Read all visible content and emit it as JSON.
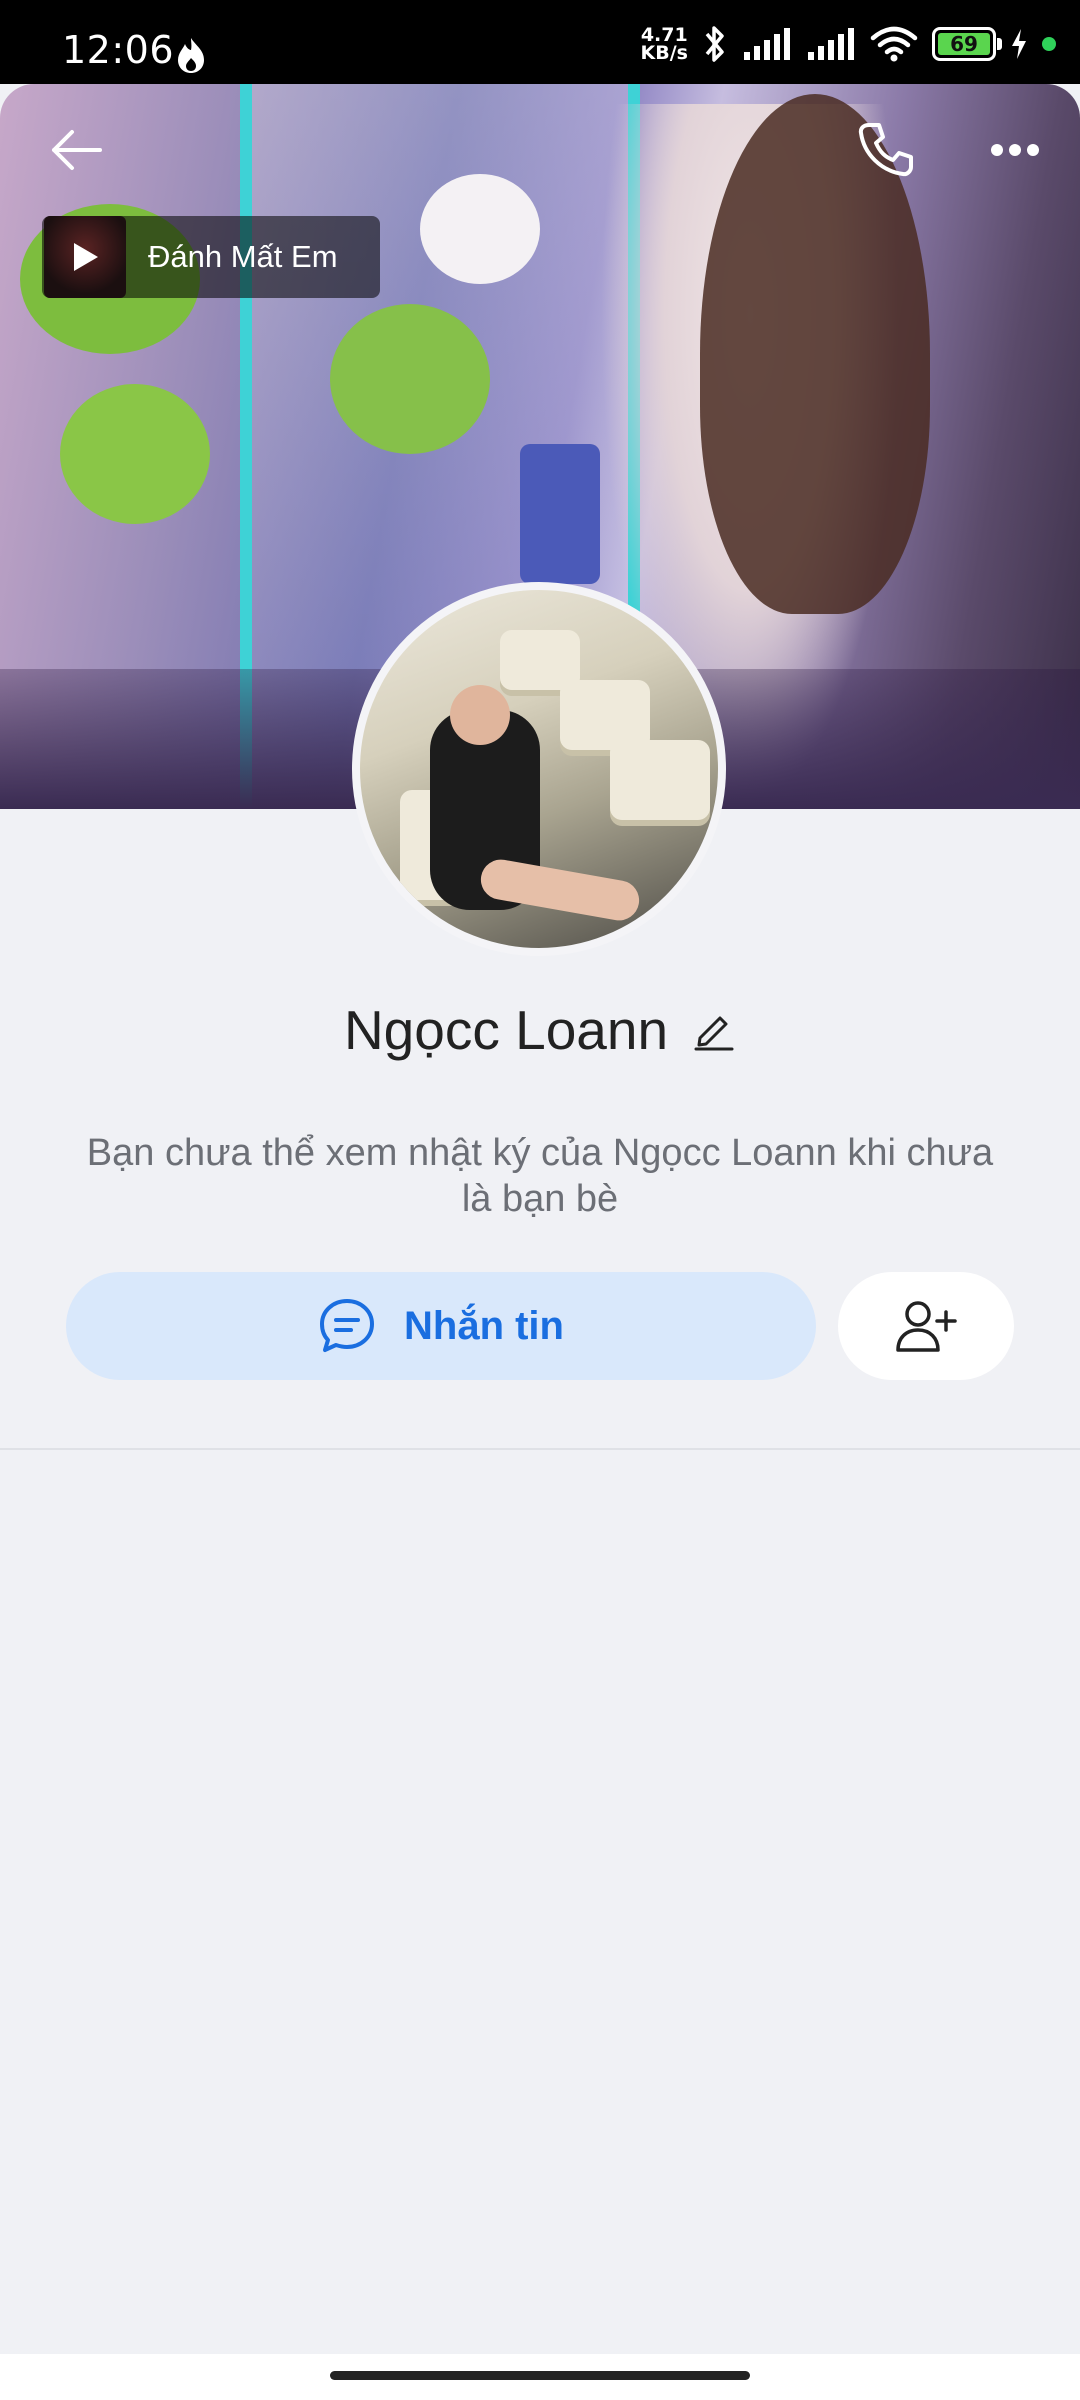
{
  "status_bar": {
    "time": "12:06",
    "net_speed_value": "4.71",
    "net_speed_unit": "KB/s",
    "battery": "69"
  },
  "cover": {
    "music_title": "Đánh Mất Em"
  },
  "profile": {
    "name": "Ngọcc Loann",
    "notice": "Bạn chưa thể xem nhật ký của Ngọcc Loann khi chưa là bạn bè"
  },
  "actions": {
    "message_label": "Nhắn tin"
  },
  "colors": {
    "accent": "#1a6ee0",
    "message_button_bg": "#d9e8fb",
    "page_bg": "#f0f1f5"
  },
  "icons": {
    "back": "arrow-left-icon",
    "call": "phone-icon",
    "more": "more-horizontal-icon",
    "play": "play-icon",
    "edit": "pencil-icon",
    "message": "chat-bubble-icon",
    "add_friend": "add-user-icon"
  }
}
